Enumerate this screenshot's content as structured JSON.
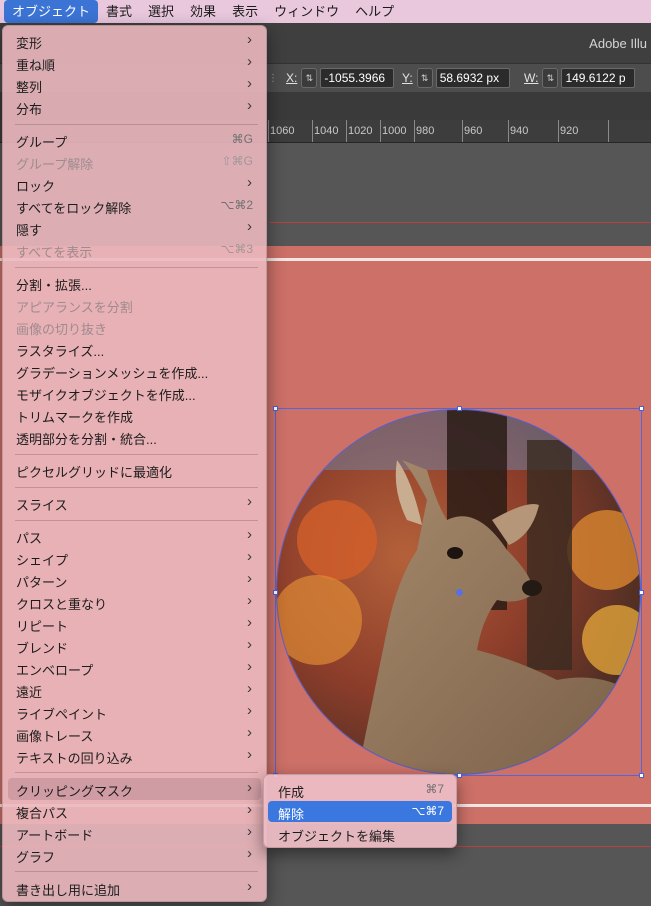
{
  "menubar": {
    "items": [
      {
        "label": "オブジェクト"
      },
      {
        "label": "書式"
      },
      {
        "label": "選択"
      },
      {
        "label": "効果"
      },
      {
        "label": "表示"
      },
      {
        "label": "ウィンドウ"
      },
      {
        "label": "ヘルプ"
      }
    ]
  },
  "app": {
    "title": "Adobe Illu"
  },
  "control_bar": {
    "x_label": "X:",
    "x_value": "-1055.3966",
    "y_label": "Y:",
    "y_value": "58.6932 px",
    "w_label": "W:",
    "w_value": "149.6122 p"
  },
  "ruler": {
    "ticks": [
      "1060",
      "1040",
      "1020",
      "1000",
      "980",
      "960",
      "940",
      "920"
    ]
  },
  "object_menu": {
    "items": [
      {
        "label": "変形",
        "submenu": true
      },
      {
        "label": "重ね順",
        "submenu": true
      },
      {
        "label": "整列",
        "submenu": true
      },
      {
        "label": "分布",
        "submenu": true
      },
      {
        "label": "グループ",
        "shortcut": "⌘G"
      },
      {
        "label": "グループ解除",
        "shortcut": "⇧⌘G",
        "disabled": true
      },
      {
        "label": "ロック",
        "submenu": true
      },
      {
        "label": "すべてをロック解除",
        "shortcut": "⌥⌘2"
      },
      {
        "label": "隠す",
        "submenu": true
      },
      {
        "label": "すべてを表示",
        "shortcut": "⌥⌘3",
        "disabled": true
      },
      {
        "label": "分割・拡張..."
      },
      {
        "label": "アピアランスを分割",
        "disabled": true
      },
      {
        "label": "画像の切り抜き",
        "disabled": true
      },
      {
        "label": "ラスタライズ..."
      },
      {
        "label": "グラデーションメッシュを作成..."
      },
      {
        "label": "モザイクオブジェクトを作成..."
      },
      {
        "label": "トリムマークを作成"
      },
      {
        "label": "透明部分を分割・統合..."
      },
      {
        "label": "ピクセルグリッドに最適化"
      },
      {
        "label": "スライス",
        "submenu": true
      },
      {
        "label": "パス",
        "submenu": true
      },
      {
        "label": "シェイプ",
        "submenu": true
      },
      {
        "label": "パターン",
        "submenu": true
      },
      {
        "label": "クロスと重なり",
        "submenu": true
      },
      {
        "label": "リピート",
        "submenu": true
      },
      {
        "label": "ブレンド",
        "submenu": true
      },
      {
        "label": "エンベロープ",
        "submenu": true
      },
      {
        "label": "遠近",
        "submenu": true
      },
      {
        "label": "ライブペイント",
        "submenu": true
      },
      {
        "label": "画像トレース",
        "submenu": true
      },
      {
        "label": "テキストの回り込み",
        "submenu": true
      },
      {
        "label": "クリッピングマスク",
        "submenu": true,
        "highlighted": true
      },
      {
        "label": "複合パス",
        "submenu": true
      },
      {
        "label": "アートボード",
        "submenu": true
      },
      {
        "label": "グラフ",
        "submenu": true
      },
      {
        "label": "書き出し用に追加",
        "submenu": true
      }
    ]
  },
  "clipping_mask_submenu": {
    "items": [
      {
        "label": "作成",
        "shortcut": "⌘7"
      },
      {
        "label": "解除",
        "shortcut": "⌥⌘7",
        "selected": true
      },
      {
        "label": "オブジェクトを編集"
      }
    ]
  },
  "colors": {
    "accent": "#3a78e0",
    "artboard": "#cc7068",
    "menu": "#ebb8be"
  }
}
